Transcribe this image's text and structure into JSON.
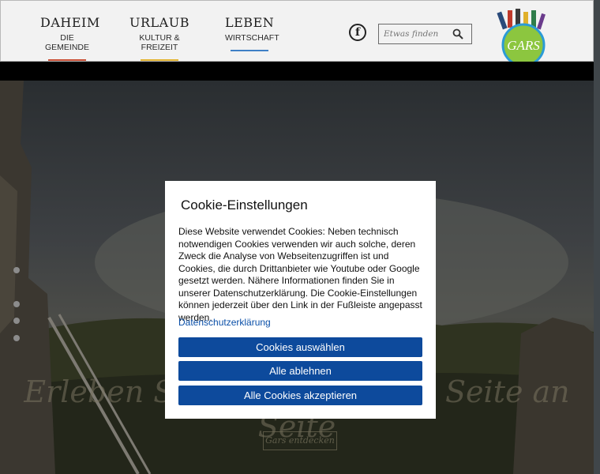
{
  "nav": [
    {
      "title": "DAHEIM",
      "sub": "DIE GEMEINDE",
      "color": "#c94f35"
    },
    {
      "title": "URLAUB",
      "sub": "KULTUR & FREIZEIT",
      "color": "#e2b331"
    },
    {
      "title": "LEBEN",
      "sub": "WIRTSCHAFT",
      "color": "#3f80c6"
    }
  ],
  "social": {
    "facebook_glyph": "f"
  },
  "search": {
    "placeholder": "Etwas finden"
  },
  "logo": {
    "text": "GARS"
  },
  "hero": {
    "headline": "Erleben Sie Gars am Kamp Seite an Seite",
    "button": "Gars entdecken"
  },
  "cookie": {
    "title": "Cookie-Einstellungen",
    "text": "Diese Website verwendet Cookies: Neben technisch notwendigen Cookies verwenden wir auch solche, deren Zweck die Analyse von Webseitenzugriffen ist und Cookies, die durch Drittanbieter wie Youtube oder Google gesetzt werden. Nähere Informationen finden Sie in unserer Datenschutzerklärung. Die Cookie-Einstellungen können jederzeit über den Link in der Fußleiste angepasst werden.",
    "link": "Datenschutzerklärung",
    "buttons": {
      "select": "Cookies auswählen",
      "reject": "Alle ablehnen",
      "accept": "Alle Cookies akzeptieren"
    }
  },
  "colors": {
    "accent": "#0d4a9c",
    "link": "#0a4fa8"
  }
}
